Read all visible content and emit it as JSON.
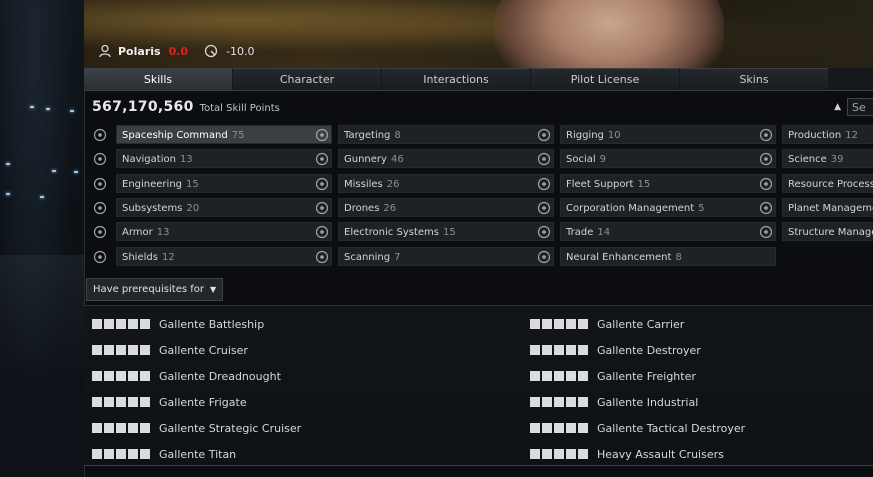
{
  "pilot": {
    "name": "Polaris",
    "security_status": "0.0",
    "standing": "-10.0",
    "colors": {
      "security": "#e0201a"
    }
  },
  "tabs": [
    {
      "label": "Skills",
      "active": true
    },
    {
      "label": "Character",
      "active": false
    },
    {
      "label": "Interactions",
      "active": false
    },
    {
      "label": "Pilot License",
      "active": false
    },
    {
      "label": "Skins",
      "active": false
    }
  ],
  "skill_points": {
    "value": "567,170,560",
    "label": "Total Skill Points"
  },
  "search": {
    "sort_icon": "sort-ascending-icon",
    "placeholder": "Se"
  },
  "skill_groups": [
    {
      "name": "Spaceship Command",
      "count": "75",
      "icon": "spaceship-command-icon",
      "selected": true
    },
    {
      "name": "Navigation",
      "count": "13",
      "icon": "navigation-icon"
    },
    {
      "name": "Engineering",
      "count": "15",
      "icon": "engineering-icon"
    },
    {
      "name": "Subsystems",
      "count": "20",
      "icon": "subsystems-icon"
    },
    {
      "name": "Armor",
      "count": "13",
      "icon": "armor-icon"
    },
    {
      "name": "Shields",
      "count": "12",
      "icon": "shields-icon"
    },
    {
      "name": "Targeting",
      "count": "8",
      "icon": "targeting-icon"
    },
    {
      "name": "Gunnery",
      "count": "46",
      "icon": "gunnery-icon"
    },
    {
      "name": "Missiles",
      "count": "26",
      "icon": "missiles-icon"
    },
    {
      "name": "Drones",
      "count": "26",
      "icon": "drones-icon"
    },
    {
      "name": "Electronic Systems",
      "count": "15",
      "icon": "electronic-systems-icon"
    },
    {
      "name": "Scanning",
      "count": "7",
      "icon": "scanning-icon"
    },
    {
      "name": "Rigging",
      "count": "10",
      "icon": "rigging-icon"
    },
    {
      "name": "Social",
      "count": "9",
      "icon": "social-icon"
    },
    {
      "name": "Fleet Support",
      "count": "15",
      "icon": "fleet-support-icon"
    },
    {
      "name": "Corporation Management",
      "count": "5",
      "icon": "corporation-management-icon"
    },
    {
      "name": "Trade",
      "count": "14",
      "icon": "trade-icon"
    },
    {
      "name": "Neural Enhancement",
      "count": "8",
      "icon": "neural-enhancement-icon"
    },
    {
      "name": "Production",
      "count": "12",
      "icon": "production-icon"
    },
    {
      "name": "Science",
      "count": "39",
      "icon": "science-icon"
    },
    {
      "name": "Resource Process",
      "count": "",
      "icon": "resource-processing-icon"
    },
    {
      "name": "Planet Manageme",
      "count": "",
      "icon": "planet-management-icon"
    },
    {
      "name": "Structure Manage",
      "count": "",
      "icon": "structure-management-icon"
    }
  ],
  "filter": {
    "label": "Have prerequisites for"
  },
  "skills": [
    {
      "name": "Gallente Battleship",
      "level": 5
    },
    {
      "name": "Gallente Cruiser",
      "level": 5
    },
    {
      "name": "Gallente Dreadnought",
      "level": 5
    },
    {
      "name": "Gallente Frigate",
      "level": 5
    },
    {
      "name": "Gallente Strategic Cruiser",
      "level": 5
    },
    {
      "name": "Gallente Titan",
      "level": 5
    },
    {
      "name": "Gallente Carrier",
      "level": 5
    },
    {
      "name": "Gallente Destroyer",
      "level": 5
    },
    {
      "name": "Gallente Freighter",
      "level": 5
    },
    {
      "name": "Gallente Industrial",
      "level": 5
    },
    {
      "name": "Gallente Tactical Destroyer",
      "level": 5
    },
    {
      "name": "Heavy Assault Cruisers",
      "level": 5
    }
  ]
}
